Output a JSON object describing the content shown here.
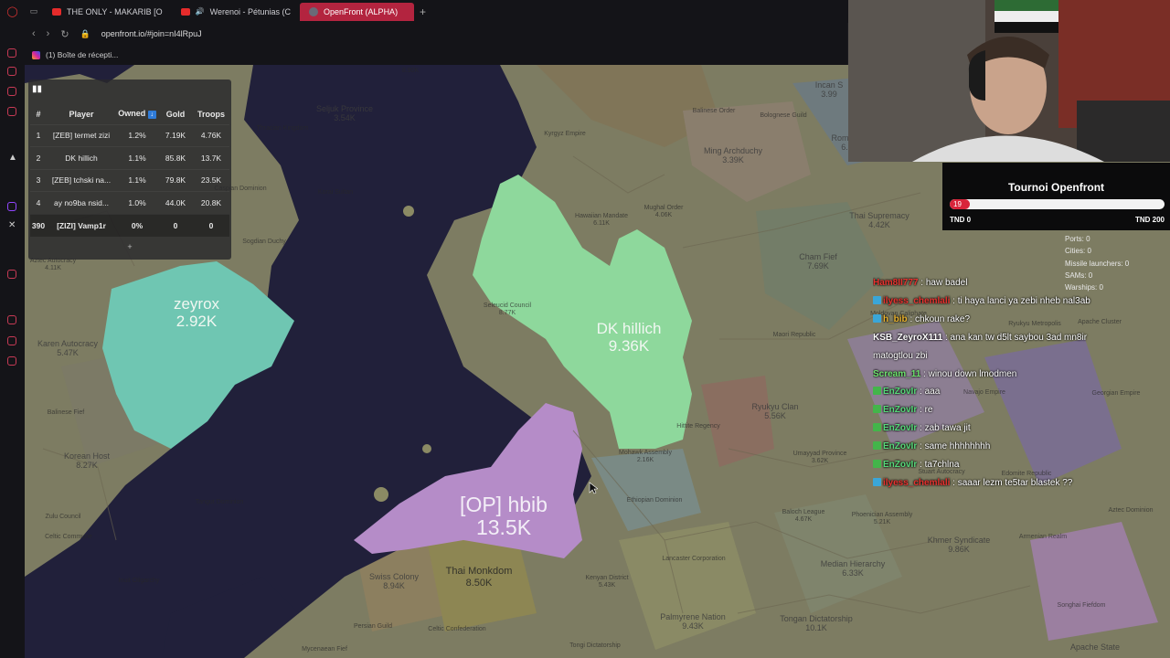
{
  "browser": {
    "tabs": [
      {
        "title": "THE ONLY - MAKARIB [O"
      },
      {
        "title": "Werenoi - Pétunias (C"
      },
      {
        "title": "OpenFront (ALPHA)"
      }
    ],
    "url": "openfront.io/#join=nI4lRpuJ",
    "bookmark": "(1) Boîte de récepti..."
  },
  "leaderboard": {
    "headers": [
      "#",
      "Player",
      "Owned",
      "Gold",
      "Troops"
    ],
    "sort_icon": "sort-down-icon",
    "rows": [
      {
        "rank": "1",
        "player": "[ZEB] termet zizi",
        "owned": "1.2%",
        "gold": "7.19K",
        "troops": "4.76K"
      },
      {
        "rank": "2",
        "player": "DK hillich",
        "owned": "1.1%",
        "gold": "85.8K",
        "troops": "13.7K"
      },
      {
        "rank": "3",
        "player": "[ZEB] tchski na...",
        "owned": "1.1%",
        "gold": "79.8K",
        "troops": "23.5K"
      },
      {
        "rank": "4",
        "player": "ay no9ba nsid...",
        "owned": "1.0%",
        "gold": "44.0K",
        "troops": "20.8K"
      },
      {
        "rank": "390",
        "player": "[ZIZI] Vamp1r",
        "owned": "0%",
        "gold": "0",
        "troops": "0"
      }
    ],
    "expand_label": "+"
  },
  "tournament": {
    "title": "Tournoi Openfront",
    "progress_label": "19",
    "progress_fraction": 0.095,
    "left_label": "TND 0",
    "right_label": "TND 200"
  },
  "stats": {
    "ports": "Ports: 0",
    "cities": "Cities: 0",
    "missile": "Missile launchers: 0",
    "sams": "SAMs: 0",
    "warships": "Warships: 0"
  },
  "chat": [
    {
      "user": "Ham8II777",
      "msg": " : haw badel",
      "color": "#e8322f",
      "badge": ""
    },
    {
      "user": "ilyess_chemlali",
      "msg": " : ti haya lanci ya zebi nheb nal3ab",
      "color": "#e8322f",
      "badge": "#3aa6d8"
    },
    {
      "user": "h_bib",
      "msg": " : chkoun rake?",
      "color": "#e8b22f",
      "badge": "#3aa6d8"
    },
    {
      "user": "KSB_ZeyroX111",
      "msg": " : ana kan tw d5lt saybou 3ad mn8ir",
      "color": "#ffffff",
      "badge": ""
    },
    {
      "user": "",
      "msg": "matogtlou zbi",
      "color": "#ffffff",
      "badge": ""
    },
    {
      "user": "Scream_11",
      "msg": " : winou down lmodmen",
      "color": "#6ee36e",
      "badge": ""
    },
    {
      "user": "EnZovIr",
      "msg": " : aaa",
      "color": "#57d97a",
      "badge": "#43b54a"
    },
    {
      "user": "EnZovIr",
      "msg": " : re",
      "color": "#57d97a",
      "badge": "#43b54a"
    },
    {
      "user": "EnZovIr",
      "msg": " : zab tawa jit",
      "color": "#57d97a",
      "badge": "#43b54a"
    },
    {
      "user": "EnZovIr",
      "msg": " : same hhhhhhhh",
      "color": "#57d97a",
      "badge": "#43b54a"
    },
    {
      "user": "EnZovIr",
      "msg": " : ta7chlna",
      "color": "#57d97a",
      "badge": "#43b54a"
    },
    {
      "user": "ilyess_chemlali",
      "msg": " : saaar lezm te5tar blastek ??",
      "color": "#e8322f",
      "badge": "#3aa6d8"
    }
  ],
  "map_labels": [
    {
      "name": "zeyrox",
      "value": "2.92K",
      "size": "xl"
    },
    {
      "name": "DK hillich",
      "value": "9.36K",
      "size": "xl"
    },
    {
      "name": "[OP] hbib",
      "value": "13.5K",
      "size": "huge"
    },
    {
      "name": "Thai Monkdom",
      "value": "8.50K",
      "size": "lg"
    },
    {
      "name": "Korean Host",
      "value": "8.27K",
      "size": "md"
    },
    {
      "name": "Cham Fief",
      "value": "7.69K",
      "size": "md"
    },
    {
      "name": "Roman",
      "value": "6.",
      "size": "md"
    },
    {
      "name": "Swiss Colony",
      "value": "8.94K",
      "size": "md"
    },
    {
      "name": "Karen Autocracy",
      "value": "5.47K",
      "size": "md"
    },
    {
      "name": "Seljuk Province",
      "value": "3.54K",
      "size": "md"
    },
    {
      "name": "Ming Archduchy",
      "value": "3.39K",
      "size": "md"
    },
    {
      "name": "Incan S",
      "value": "3.99",
      "size": "md"
    },
    {
      "name": "Ryukyu Clan",
      "value": "5.56K",
      "size": "md"
    },
    {
      "name": "Median Hierarchy",
      "value": "6.33K",
      "size": "md"
    },
    {
      "name": "Palmyrene Nation",
      "value": "9.43K",
      "size": "md"
    },
    {
      "name": "Tongan Dictatorship",
      "value": "10.1K",
      "size": "md"
    },
    {
      "name": "Khmer Syndicate",
      "value": "9.86K",
      "size": "md"
    },
    {
      "name": "Thai Supremacy",
      "value": "4.42K",
      "size": "md"
    },
    {
      "name": "Apache State",
      "value": "",
      "size": "md"
    },
    {
      "name": "Seleucid Council",
      "value": "8.77K",
      "size": "sm"
    },
    {
      "name": "Thracian Kingdom",
      "value": "",
      "size": "sm"
    },
    {
      "name": "Hawaiian Mandate",
      "value": "6.11K",
      "size": "sm"
    },
    {
      "name": "Umayyad Province",
      "value": "3.62K",
      "size": "sm"
    },
    {
      "name": "Apache Cluster",
      "value": "",
      "size": "sm"
    },
    {
      "name": "Kenyan District",
      "value": "5.43K",
      "size": "sm"
    },
    {
      "name": "Ethiopian Dominion",
      "value": "",
      "size": "sm"
    },
    {
      "name": "Lancaster Corporation",
      "value": "",
      "size": "sm"
    },
    {
      "name": "Kyrgyz Empire",
      "value": "",
      "size": "sm"
    },
    {
      "name": "Mughal Order",
      "value": "4.06K",
      "size": "sm"
    },
    {
      "name": "Balinese Order",
      "value": "",
      "size": "sm"
    },
    {
      "name": "Bolognese Guild",
      "value": "",
      "size": "sm"
    },
    {
      "name": "Maori Republic",
      "value": "",
      "size": "sm"
    },
    {
      "name": "Phoenician Assembly",
      "value": "5.21K",
      "size": "sm"
    },
    {
      "name": "Baloch League",
      "value": "4.67K",
      "size": "sm"
    },
    {
      "name": "Celtic Confederation",
      "value": "",
      "size": "sm"
    },
    {
      "name": "Persian Guild",
      "value": "",
      "size": "sm"
    },
    {
      "name": "Zulu Council",
      "value": "",
      "size": "sm"
    },
    {
      "name": "Inuit Oligarchy",
      "value": "",
      "size": "sm"
    },
    {
      "name": "Tangut Dominion",
      "value": "",
      "size": "sm"
    },
    {
      "name": "Mycenaean Fief",
      "value": "",
      "size": "sm"
    },
    {
      "name": "Moldovan Caliphate",
      "value": "",
      "size": "sm"
    },
    {
      "name": "Mohawk Assembly",
      "value": "2.16K",
      "size": "sm"
    },
    {
      "name": "Stuart Autocracy",
      "value": "",
      "size": "sm"
    },
    {
      "name": "Armenian Realm",
      "value": "",
      "size": "sm"
    },
    {
      "name": "Songhai Fiefdom",
      "value": "",
      "size": "sm"
    },
    {
      "name": "Georgian Empire",
      "value": "",
      "size": "sm"
    },
    {
      "name": "Aztec Dominion",
      "value": "",
      "size": "sm"
    },
    {
      "name": "Tongi Dictatorship",
      "value": "",
      "size": "sm"
    },
    {
      "name": "Caspian Dominion",
      "value": "",
      "size": "sm"
    },
    {
      "name": "Sogdian Duchy",
      "value": "",
      "size": "sm"
    },
    {
      "name": "Korai Sultan",
      "value": "",
      "size": "sm"
    },
    {
      "name": "Balinese Fief",
      "value": "",
      "size": "sm"
    },
    {
      "name": "Celtic Commune",
      "value": "",
      "size": "sm"
    },
    {
      "name": "Ryukyu Metropolis",
      "value": "",
      "size": "sm"
    },
    {
      "name": "Edomite Republic",
      "value": "",
      "size": "sm"
    },
    {
      "name": "Hittite Regency",
      "value": "",
      "size": "sm"
    },
    {
      "name": "Navajo Empire",
      "value": "",
      "size": "sm"
    },
    {
      "name": "Aztec Autocracy",
      "value": "4.11K",
      "size": "sm"
    },
    {
      "name": "",
      "value": "8.90K",
      "size": "sm"
    }
  ]
}
